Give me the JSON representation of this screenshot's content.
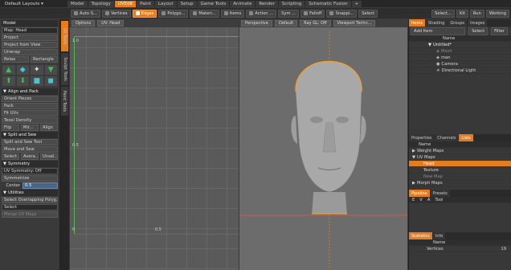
{
  "topbar": {
    "layouts": "Default Layouts ▾",
    "tabs": [
      "Model",
      "Topology",
      "UVEdit",
      "Paint",
      "Layout",
      "Setup",
      "Game Tools",
      "Animate",
      "Render",
      "Scripting",
      "Schematic Fusion"
    ],
    "active_tab": "UVEdit",
    "plus": "+"
  },
  "toolbar": {
    "buttons": [
      "Auto S...",
      "Vertices",
      "Edges",
      "Polygo...",
      "Materi...",
      "Items",
      "Action ...",
      "Sym ...",
      "Falloff",
      "Snappi...",
      "Select"
    ],
    "active": "Edges",
    "right": [
      "Select...",
      "Kit",
      "Run",
      "Working"
    ]
  },
  "left": {
    "title": "Model",
    "rows": [
      "Map: Head",
      "Project",
      "Project from View",
      "Unwrap"
    ],
    "relax": "Relax",
    "rectangle": "Rectangle",
    "align_pack": "Align and Pack",
    "orient": "Orient Pieces",
    "pack": "Pack",
    "fit": "Fit UVs",
    "texel": "Texel Density",
    "flip": "Flip",
    "mir": "Mir...",
    "align": "Align",
    "split_sew": "Split and Sew",
    "split_tool": "Split and Sew Tool",
    "move_sew": "Move and Sew",
    "select": "Select...",
    "avera": "Avera...",
    "unsel": "Unsel...",
    "symmetry": "Symmetry",
    "uv_sym": "UV Symmetry: Off",
    "symmetrize": "Symmetrize",
    "center_label": "Center",
    "center_value": "0.5",
    "utilities": "Utilities",
    "sel_overlap": "Select Overlapping Polyg...",
    "select2": "Select",
    "merge": "Merge UV Maps",
    "vtabs": [
      "UV Tools",
      "Sculpt Tools",
      "Paint Tools"
    ]
  },
  "uv": {
    "options": "Options",
    "map": "UV: Head",
    "t1": "1.0",
    "t05": "0.5",
    "t0": "0",
    "tx05": "0.5"
  },
  "persp": {
    "view": "Perspective",
    "default": "Default",
    "ray": "Ray GL: Off",
    "tech": "Viewport Techn..."
  },
  "right": {
    "tabs": [
      "Items",
      "Shading",
      "Groups",
      "Images"
    ],
    "add_item": "Add Item",
    "select": "Select",
    "filter": "Filter",
    "col_name": "Name",
    "items": [
      "Untitled*",
      "Mesh",
      "man",
      "Camera",
      "Directional Light"
    ],
    "tabs2": [
      "Properties",
      "Channels",
      "Lists"
    ],
    "list_name": "Name",
    "lists": [
      "Weight Maps",
      "UV Maps",
      "Head",
      "Texture",
      "New Map",
      "Morph Maps"
    ],
    "pipeline": "Pipeline",
    "presets": "Presets",
    "cols": [
      "E",
      "V",
      "A",
      "Tool"
    ],
    "stats": "Statistics",
    "info": "Info",
    "stats_name": "Name",
    "vertices": "Vertices",
    "vcount": "19"
  }
}
